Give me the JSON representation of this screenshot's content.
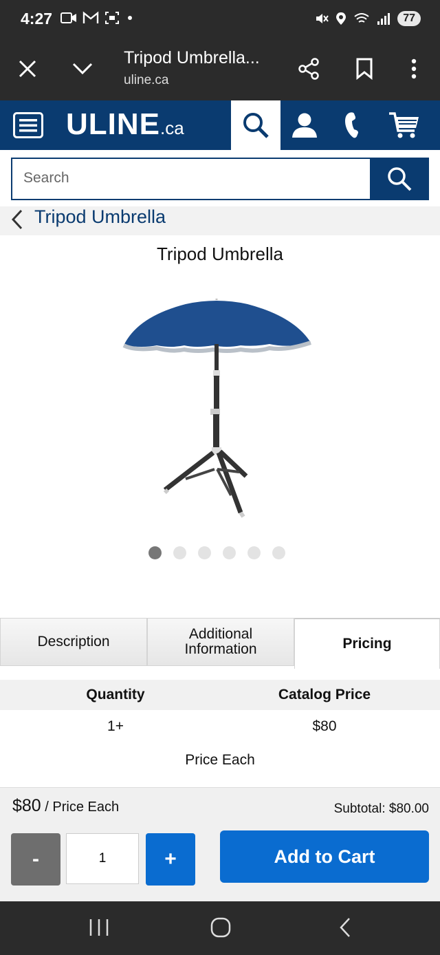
{
  "status": {
    "time": "4:27",
    "battery": "77"
  },
  "browser": {
    "title": "Tripod Umbrella...",
    "url": "uline.ca"
  },
  "header": {
    "logo": "ULINE",
    "logo_suffix": ".ca"
  },
  "search": {
    "placeholder": "Search"
  },
  "breadcrumb": {
    "label": "Tripod Umbrella"
  },
  "product": {
    "title": "Tripod Umbrella",
    "image_dots": 6,
    "active_dot": 0
  },
  "tabs": [
    {
      "label": "Description"
    },
    {
      "label_line1": "Additional",
      "label_line2": "Information"
    },
    {
      "label": "Pricing"
    }
  ],
  "pricing": {
    "quantity_header": "Quantity",
    "catalog_header": "Catalog Price",
    "quantity": "1+",
    "price": "$80",
    "price_note": "Price Each"
  },
  "cart": {
    "price": "$80",
    "price_unit": " / Price Each",
    "subtotal": "Subtotal: $80.00",
    "minus": "-",
    "plus": "+",
    "quantity_value": "1",
    "add_label": "Add to Cart"
  },
  "colors": {
    "brand_navy": "#0a3b70",
    "button_blue": "#0a6cd0",
    "umbrella_blue": "#1f4f8f"
  }
}
